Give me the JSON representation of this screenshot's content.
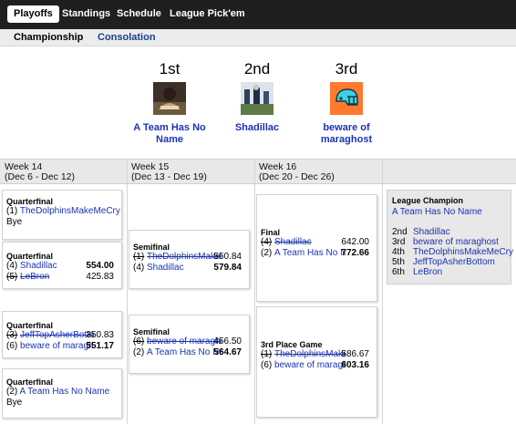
{
  "nav": {
    "tabs": [
      {
        "label": "Playoffs",
        "active": true
      },
      {
        "label": "Standings",
        "active": false
      },
      {
        "label": "Schedule",
        "active": false
      },
      {
        "label": "League Pick'em",
        "active": false
      }
    ]
  },
  "subnav": {
    "tabs": [
      {
        "label": "Championship",
        "active": true
      },
      {
        "label": "Consolation",
        "active": false
      }
    ]
  },
  "podium": [
    {
      "place": "1st",
      "team": "A Team Has No Name"
    },
    {
      "place": "2nd",
      "team": "Shadillac"
    },
    {
      "place": "3rd",
      "team": "beware of maraghost"
    }
  ],
  "weeks": [
    {
      "label": "Week 14",
      "dates": "(Dec 6 - Dec 12)"
    },
    {
      "label": "Week 15",
      "dates": "(Dec 13 - Dec 19)"
    },
    {
      "label": "Week 16",
      "dates": "(Dec 20 - Dec 26)"
    }
  ],
  "week14": {
    "qf1": {
      "title": "Quarterfinal",
      "seed": "(1)",
      "team": "TheDolphinsMakeMeCry",
      "bye": "Bye"
    },
    "qf2": {
      "title": "Quarterfinal",
      "a_seed": "(4)",
      "a_team": "Shadillac",
      "a_pts": "554.00",
      "b_seed": "(5)",
      "b_team": "LeBron",
      "b_pts": "425.83"
    },
    "qf3": {
      "title": "Quarterfinal",
      "a_seed": "(3)",
      "a_team": "JeffTopAsherBottom",
      "a_pts": "350.83",
      "b_seed": "(6)",
      "b_team": "beware of maraghost",
      "b_pts": "551.17"
    },
    "qf4": {
      "title": "Quarterfinal",
      "seed": "(2)",
      "team": "A Team Has No Name",
      "bye": "Bye"
    }
  },
  "week15": {
    "sf1": {
      "title": "Semifinal",
      "a_seed": "(1)",
      "a_team": "TheDolphinsMakeMeCry",
      "a_pts": "550.84",
      "b_seed": "(4)",
      "b_team": "Shadillac",
      "b_pts": "579.84"
    },
    "sf2": {
      "title": "Semifinal",
      "a_seed": "(6)",
      "a_team": "beware of maraghost",
      "a_pts": "456.50",
      "b_seed": "(2)",
      "b_team": "A Team Has No Name",
      "b_pts": "564.67"
    }
  },
  "week16": {
    "final": {
      "title": "Final",
      "a_seed": "(4)",
      "a_team": "Shadillac",
      "a_pts": "642.00",
      "b_seed": "(2)",
      "b_team": "A Team Has No Name",
      "b_pts": "772.66"
    },
    "third": {
      "title": "3rd Place Game",
      "a_seed": "(1)",
      "a_team": "TheDolphinsMakeMeCry",
      "a_pts": "586.67",
      "b_seed": "(6)",
      "b_team": "beware of maraghost",
      "b_pts": "603.16"
    }
  },
  "champion": {
    "title": "League Champion",
    "team": "A Team Has No Name",
    "ranks": [
      {
        "place": "2nd",
        "team": "Shadillac"
      },
      {
        "place": "3rd",
        "team": "beware of maraghost"
      },
      {
        "place": "4th",
        "team": "TheDolphinsMakeMeCry"
      },
      {
        "place": "5th",
        "team": "JeffTopAsherBottom"
      },
      {
        "place": "6th",
        "team": "LeBron"
      }
    ]
  },
  "colors": {
    "link": "#1a33b3",
    "nav_bg": "#1f1f1f",
    "header_bg": "#e8e8e8",
    "helmet": "#ff7a2e"
  }
}
